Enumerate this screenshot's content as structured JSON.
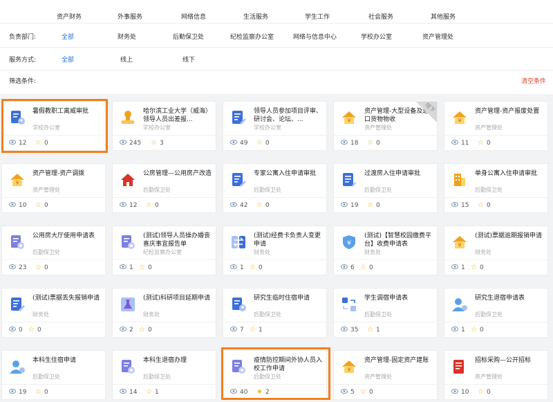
{
  "categories": [
    "资产财务",
    "外事服务",
    "网络信息",
    "生活服务",
    "学生工作",
    "社会服务",
    "其他服务"
  ],
  "filters": {
    "dept_label": "负责部门:",
    "dept_options": [
      "全部",
      "财务处",
      "后勤保卫处",
      "纪检监察办公室",
      "网络与信息中心",
      "学校办公室",
      "资产管理处"
    ],
    "mode_label": "服务方式:",
    "mode_options": [
      "全部",
      "线上",
      "线下"
    ],
    "cond_label": "筛选条件:",
    "clear_label": "清空条件"
  },
  "colors": {
    "accent": "#1e6fd9",
    "clear": "#e0452f",
    "highlight": "#f08020",
    "star": "#f0b21b"
  },
  "cards": [
    {
      "title": "暑假教职工离威审批",
      "dept": "学校办公室",
      "views": "12",
      "favs": "0",
      "icon": "document-user-icon"
    },
    {
      "title": "哈尔滨工业大学（威海）领导人员出差报...",
      "dept": "学校办公室",
      "views": "245",
      "favs": "3",
      "icon": "stamp-icon"
    },
    {
      "title": "领导人员参加项目评审、研讨会、论坛、...",
      "dept": "学校办公室",
      "views": "49",
      "favs": "0",
      "icon": "document-edit-icon"
    },
    {
      "title": "资产管理-大型设备及进口货物物收",
      "dept": "资产管理处",
      "views": "18",
      "favs": "0",
      "icon": "house-money-icon",
      "ribbon": "线下"
    },
    {
      "title": "资产管理-资产报废处置",
      "dept": "资产管理处",
      "views": "11",
      "favs": "0",
      "icon": "house-money-icon"
    },
    {
      "title": "资产管理-资产调拨",
      "dept": "资产管理处",
      "views": "10",
      "favs": "0",
      "icon": "house-money-icon"
    },
    {
      "title": "公房管理—公用房产改造",
      "dept": "后勤保卫处",
      "views": "12",
      "favs": "0",
      "icon": "house-icon"
    },
    {
      "title": "专家公寓入住申请审批",
      "dept": "后勤保卫处",
      "views": "42",
      "favs": "0",
      "icon": "document-edit-icon"
    },
    {
      "title": "过渡房入住申请审批",
      "dept": "后勤保卫处",
      "views": "19",
      "favs": "0",
      "icon": "document-list-icon"
    },
    {
      "title": "单身公寓入住申请审批",
      "dept": "后勤保卫处",
      "views": "15",
      "favs": "0",
      "icon": "building-icon"
    },
    {
      "title": "公用房大厅使用申请表",
      "dept": "后勤保卫处",
      "views": "23",
      "favs": "0",
      "icon": "document-gear-icon"
    },
    {
      "title": "(测试)领导人员操办婚丧喜庆事宜报告单",
      "dept": "纪检监察办公室",
      "views": "1",
      "favs": "0",
      "icon": "document-gear-icon"
    },
    {
      "title": "(测试)经费卡负责人变更申请",
      "dept": "财务处",
      "views": "1",
      "favs": "0",
      "icon": "swap-icon"
    },
    {
      "title": "(测试)【智慧校园缴费平台】收费申请表",
      "dept": "财务处",
      "views": "6",
      "favs": "0",
      "icon": "shield-money-icon"
    },
    {
      "title": "(测试)票据逾期报销申请",
      "dept": "财务处",
      "views": "1",
      "favs": "0",
      "icon": "house-money-icon"
    },
    {
      "title": "(测试)票据丢失报销申请",
      "dept": "财务处",
      "views": "0",
      "favs": "0",
      "icon": "document-edit-icon"
    },
    {
      "title": "(测试)科研项目延期申请",
      "dept": "财务处",
      "views": "2",
      "favs": "0",
      "icon": "flask-icon"
    },
    {
      "title": "研究生临时住宿申请",
      "dept": "后勤保卫处",
      "views": "7",
      "favs": "1",
      "icon": "document-user-icon"
    },
    {
      "title": "学生调宿申请表",
      "dept": "后勤保卫处",
      "views": "35",
      "favs": "1",
      "icon": "swap-grid-icon"
    },
    {
      "title": "研究生退宿申请表",
      "dept": "后勤保卫处",
      "views": "1",
      "favs": "0",
      "icon": "user-icon"
    },
    {
      "title": "本科生住宿申请",
      "dept": "后勤保卫处",
      "views": "19",
      "favs": "0",
      "icon": "user-icon"
    },
    {
      "title": "本科生退宿办理",
      "dept": "后勤保卫处",
      "views": "14",
      "favs": "1",
      "icon": "document-gear-icon"
    },
    {
      "title": "疫情防控期间外协人员入校工作申请",
      "dept": "后勤保卫处",
      "views": "40",
      "favs": "2",
      "icon": "document-gear-icon"
    },
    {
      "title": "资产管理-固定资产建账",
      "dept": "资产管理处",
      "views": "5",
      "favs": "0",
      "icon": "house-money-icon"
    },
    {
      "title": "招标采购—公开招标",
      "dept": "资产管理处",
      "views": "10",
      "favs": "0",
      "icon": "book-icon"
    }
  ]
}
